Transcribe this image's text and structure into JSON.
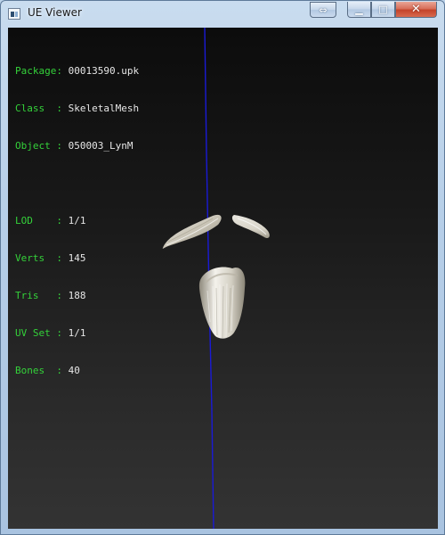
{
  "window": {
    "title": "UE Viewer",
    "buttons": {
      "resize_icon": "double-arrow-icon",
      "minimize_icon": "minimize-icon",
      "maximize_icon": "maximize-icon",
      "close_icon": "close-icon"
    }
  },
  "info": {
    "package": {
      "label": "Package",
      "sep": ": ",
      "value": "00013590.upk"
    },
    "class": {
      "label": "Class  ",
      "sep": ": ",
      "value": "SkeletalMesh"
    },
    "object": {
      "label": "Object ",
      "sep": ": ",
      "value": "050003_LynM"
    },
    "lod": {
      "label": "LOD    ",
      "sep": ": ",
      "value": "1/1"
    },
    "verts": {
      "label": "Verts  ",
      "sep": ": ",
      "value": "145"
    },
    "tris": {
      "label": "Tris   ",
      "sep": ": ",
      "value": "188"
    },
    "uvset": {
      "label": "UV Set ",
      "sep": ": ",
      "value": "1/1"
    },
    "bones": {
      "label": "Bones  ",
      "sep": ": ",
      "value": "40"
    }
  },
  "colors": {
    "label_green": "#34d23a",
    "value_white": "#e6e6e6",
    "axis_blue": "#1a1ad6",
    "close_red": "#c4432a"
  }
}
